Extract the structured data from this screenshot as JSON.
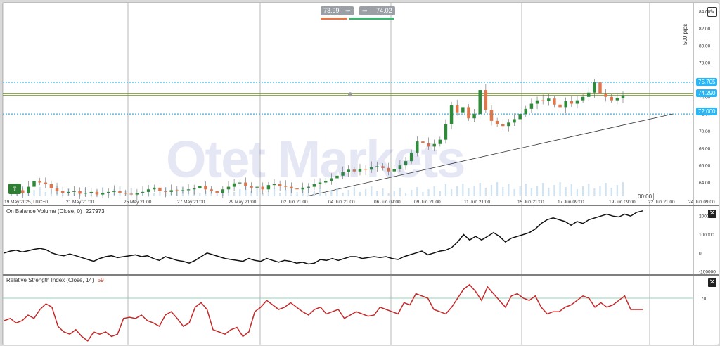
{
  "toolbar": {
    "bid": "73.99",
    "ask": "74.02",
    "bid_sep": "⇒",
    "ask_sep": "⇒"
  },
  "watermark": "Otet Markets",
  "main_scale_label": "500 pips",
  "badges": {
    "upper": "75.705",
    "current": "74.290",
    "lower": "72.000"
  },
  "time_tag": "00:00",
  "obv_title": "On Balance Volume (Close, 0)",
  "obv_value": "227973",
  "rsi_title": "Relative Strength Index (Close, 14)",
  "rsi_value": "59",
  "colors": {
    "up": "#2e8b3a",
    "down": "#e0764a",
    "hline": "#29b6f6",
    "current_line": "#6b8e23",
    "obv_line": "#111111",
    "rsi_line": "#c62828",
    "rsi_level": "#8fd6b9"
  },
  "chart_data": [
    {
      "type": "candlestick",
      "x_tick_labels": [
        "19 May 2025, UTC+0",
        "21 May 21:00",
        "25 May 21:00",
        "27 May 21:00",
        "29 May 21:00",
        "02 Jun 21:00",
        "04 Jun 21:00",
        "06 Jun 09:00",
        "09 Jun 21:00",
        "11 Jun 21:00",
        "15 Jun 21:00",
        "17 Jun 09:00",
        "19 Jun 09:00",
        "22 Jun 21:00",
        "24 Jun 09:00"
      ],
      "y_ticks": [
        64.0,
        66.0,
        68.0,
        70.0,
        72.0,
        74.0,
        76.0,
        78.0,
        80.0,
        82.0,
        84.0
      ],
      "y_tick_labels": [
        "64.00",
        "66.00",
        "68.00",
        "70.00",
        "72.00",
        "74.00",
        "76.00",
        "78.00",
        "80.00",
        "82.00",
        "84.00"
      ],
      "ylim": [
        62.4,
        84.5
      ],
      "horizontal_lines": [
        75.705,
        74.29,
        72.0
      ],
      "trendline": {
        "from": [
          0.44,
          62.4
        ],
        "to": [
          0.97,
          72.0
        ]
      },
      "close": [
        62.9,
        63.1,
        62.8,
        63.5,
        64.2,
        64.0,
        63.8,
        63.3,
        63.0,
        62.8,
        62.9,
        63.0,
        62.7,
        62.8,
        62.9,
        62.6,
        62.8,
        62.9,
        63.0,
        62.8,
        62.7,
        62.6,
        62.8,
        62.9,
        63.2,
        63.4,
        63.0,
        62.9,
        63.1,
        63.0,
        63.1,
        63.2,
        63.3,
        63.6,
        63.2,
        63.0,
        62.8,
        63.2,
        63.5,
        63.9,
        64.0,
        63.6,
        63.4,
        63.5,
        63.2,
        63.7,
        63.8,
        63.6,
        63.5,
        63.3,
        63.2,
        63.4,
        63.5,
        63.8,
        64.0,
        64.2,
        64.5,
        64.8,
        65.2,
        65.5,
        65.3,
        65.6,
        65.5,
        65.8,
        65.9,
        65.7,
        65.3,
        65.6,
        66.0,
        66.5,
        67.5,
        68.8,
        68.6,
        68.2,
        68.5,
        69.0,
        70.8,
        73.0,
        72.2,
        72.8,
        71.5,
        72.0,
        74.8,
        72.5,
        71.2,
        70.8,
        70.6,
        71.0,
        71.4,
        72.0,
        72.6,
        73.2,
        73.6,
        73.5,
        73.8,
        73.1,
        72.8,
        73.5,
        73.2,
        73.6,
        74.0,
        74.5,
        75.7,
        74.4,
        74.0,
        73.6,
        73.9,
        74.2
      ]
    },
    {
      "type": "line",
      "name": "On Balance Volume (Close, 0)",
      "y_ticks": [
        -100000,
        0,
        100000,
        200000
      ],
      "y_tick_labels": [
        "-100000",
        "0",
        "100000",
        "200000"
      ],
      "ylim": [
        -115000,
        250000
      ],
      "values": [
        0,
        10000,
        15000,
        5000,
        12000,
        20000,
        25000,
        18000,
        0,
        -10000,
        -15000,
        -5000,
        -15000,
        -25000,
        -35000,
        -45000,
        -30000,
        -20000,
        -15000,
        -25000,
        -20000,
        -15000,
        -10000,
        -20000,
        -15000,
        -30000,
        -40000,
        -20000,
        -30000,
        -40000,
        -45000,
        -55000,
        -40000,
        -20000,
        0,
        -10000,
        -20000,
        -30000,
        -35000,
        -40000,
        -45000,
        -30000,
        -40000,
        -45000,
        -30000,
        -40000,
        -50000,
        -40000,
        -45000,
        -55000,
        -50000,
        -60000,
        -55000,
        -35000,
        -40000,
        -30000,
        -40000,
        -30000,
        -20000,
        -20000,
        -30000,
        -25000,
        -20000,
        -25000,
        -20000,
        -30000,
        -35000,
        -20000,
        -10000,
        0,
        10000,
        -10000,
        0,
        10000,
        15000,
        30000,
        60000,
        100000,
        70000,
        90000,
        70000,
        90000,
        110000,
        90000,
        60000,
        80000,
        90000,
        100000,
        110000,
        130000,
        160000,
        180000,
        190000,
        180000,
        170000,
        150000,
        170000,
        160000,
        180000,
        190000,
        200000,
        210000,
        200000,
        195000,
        210000,
        200000,
        220000,
        228000
      ]
    },
    {
      "type": "line",
      "name": "Relative Strength Index (Close, 14)",
      "y_ticks": [
        70
      ],
      "y_tick_labels": [
        "70"
      ],
      "ylim": [
        30,
        90
      ],
      "level": 70,
      "values": [
        50,
        52,
        48,
        50,
        55,
        52,
        60,
        65,
        62,
        45,
        40,
        38,
        42,
        36,
        32,
        40,
        38,
        40,
        36,
        38,
        52,
        53,
        52,
        55,
        50,
        48,
        45,
        55,
        58,
        52,
        45,
        48,
        62,
        66,
        60,
        42,
        40,
        38,
        42,
        44,
        36,
        40,
        58,
        62,
        68,
        64,
        60,
        62,
        66,
        62,
        58,
        55,
        60,
        62,
        56,
        58,
        60,
        52,
        55,
        58,
        56,
        54,
        55,
        62,
        60,
        58,
        56,
        66,
        64,
        74,
        72,
        70,
        60,
        58,
        56,
        62,
        70,
        78,
        82,
        76,
        68,
        80,
        74,
        68,
        62,
        72,
        74,
        70,
        68,
        72,
        62,
        56,
        58,
        58,
        62,
        64,
        68,
        72,
        70,
        62,
        66,
        62,
        64,
        68,
        72,
        60,
        60,
        60
      ]
    }
  ]
}
